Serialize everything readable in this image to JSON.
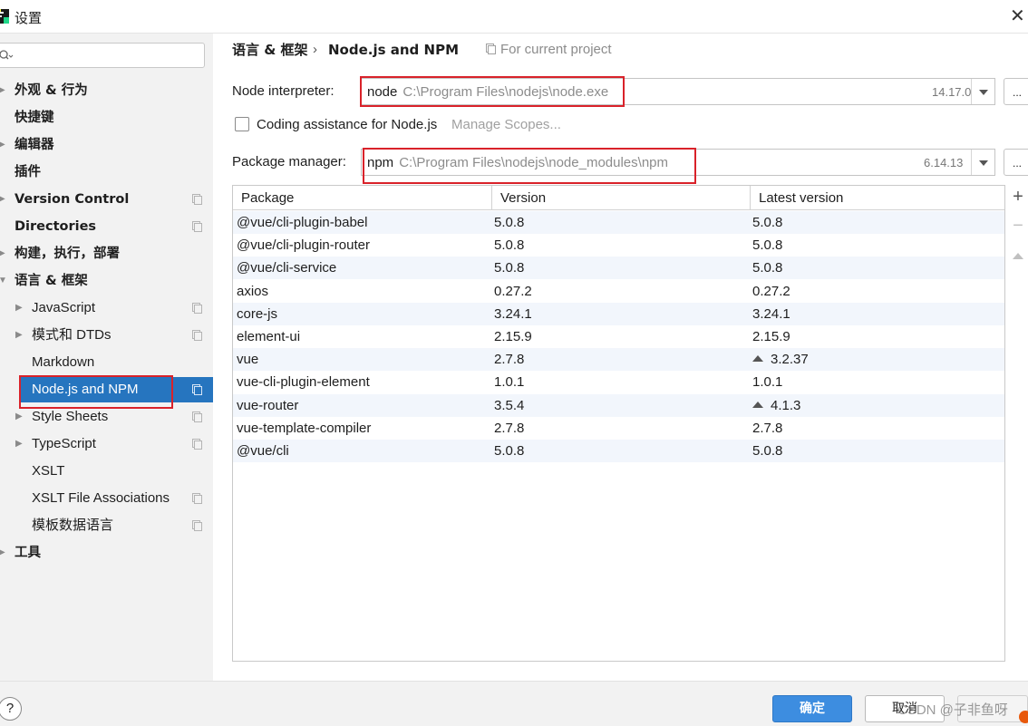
{
  "window": {
    "title": "设置"
  },
  "sidebar": {
    "search_placeholder": "",
    "items": [
      {
        "label": "外观 & 行为"
      },
      {
        "label": "快捷键"
      },
      {
        "label": "编辑器"
      },
      {
        "label": "插件"
      },
      {
        "label": "Version Control"
      },
      {
        "label": "Directories"
      },
      {
        "label": "构建，执行，部署"
      },
      {
        "label": "语言 & 框架"
      },
      {
        "label": "JavaScript"
      },
      {
        "label": "模式和 DTDs"
      },
      {
        "label": "Markdown"
      },
      {
        "label": "Node.js and NPM"
      },
      {
        "label": "Style Sheets"
      },
      {
        "label": "TypeScript"
      },
      {
        "label": "XSLT"
      },
      {
        "label": "XSLT File Associations"
      },
      {
        "label": "模板数据语言"
      },
      {
        "label": "工具"
      }
    ]
  },
  "header": {
    "breadcrumb_parent": "语言 & 框架",
    "breadcrumb_current": "Node.js and NPM",
    "scope_label": "For current project"
  },
  "interpreter": {
    "label": "Node interpreter:",
    "name": "node",
    "path": "C:\\Program Files\\nodejs\\node.exe",
    "version": "14.17.0",
    "more": "..."
  },
  "coding_assistance": {
    "label": "Coding assistance for Node.js",
    "checked": false,
    "manage_scopes": "Manage Scopes..."
  },
  "package_manager": {
    "label": "Package manager:",
    "name": "npm",
    "path": "C:\\Program Files\\nodejs\\node_modules\\npm",
    "version": "6.14.13",
    "more": "..."
  },
  "packages": {
    "columns": [
      "Package",
      "Version",
      "Latest version"
    ],
    "rows": [
      {
        "name": "@vue/cli-plugin-babel",
        "version": "5.0.8",
        "latest": "5.0.8",
        "upgrade": false
      },
      {
        "name": "@vue/cli-plugin-router",
        "version": "5.0.8",
        "latest": "5.0.8",
        "upgrade": false
      },
      {
        "name": "@vue/cli-service",
        "version": "5.0.8",
        "latest": "5.0.8",
        "upgrade": false
      },
      {
        "name": "axios",
        "version": "0.27.2",
        "latest": "0.27.2",
        "upgrade": false
      },
      {
        "name": "core-js",
        "version": "3.24.1",
        "latest": "3.24.1",
        "upgrade": false
      },
      {
        "name": "element-ui",
        "version": "2.15.9",
        "latest": "2.15.9",
        "upgrade": false
      },
      {
        "name": "vue",
        "version": "2.7.8",
        "latest": "3.2.37",
        "upgrade": true
      },
      {
        "name": "vue-cli-plugin-element",
        "version": "1.0.1",
        "latest": "1.0.1",
        "upgrade": false
      },
      {
        "name": "vue-router",
        "version": "3.5.4",
        "latest": "4.1.3",
        "upgrade": true
      },
      {
        "name": "vue-template-compiler",
        "version": "2.7.8",
        "latest": "2.7.8",
        "upgrade": false
      },
      {
        "name": "@vue/cli",
        "version": "5.0.8",
        "latest": "5.0.8",
        "upgrade": false
      }
    ]
  },
  "footer": {
    "help": "?",
    "ok": "确定",
    "cancel": "取消",
    "apply": "",
    "watermark": "CSDN @子非鱼呀"
  },
  "colors": {
    "selection": "#2675bf",
    "highlight_box": "#d9222a",
    "ok_button": "#3d8de0",
    "row_alt": "#f2f6fc"
  }
}
